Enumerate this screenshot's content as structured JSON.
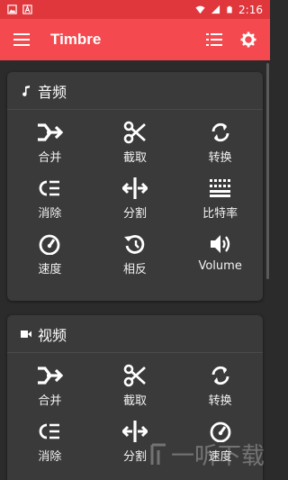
{
  "status_bar": {
    "time": "2:16"
  },
  "app_bar": {
    "title": "Timbre"
  },
  "audio_card": {
    "title": "音频",
    "tools": [
      {
        "label": "合并",
        "icon": "merge-icon"
      },
      {
        "label": "截取",
        "icon": "scissors-icon"
      },
      {
        "label": "转换",
        "icon": "convert-icon"
      },
      {
        "label": "消除",
        "icon": "remove-icon"
      },
      {
        "label": "分割",
        "icon": "split-icon"
      },
      {
        "label": "比特率",
        "icon": "bitrate-icon"
      },
      {
        "label": "速度",
        "icon": "speed-icon"
      },
      {
        "label": "相反",
        "icon": "reverse-icon"
      },
      {
        "label": "Volume",
        "icon": "volume-icon"
      }
    ]
  },
  "video_card": {
    "title": "视频",
    "tools": [
      {
        "label": "合并",
        "icon": "merge-icon"
      },
      {
        "label": "截取",
        "icon": "scissors-icon"
      },
      {
        "label": "转换",
        "icon": "convert-icon"
      },
      {
        "label": "消除",
        "icon": "remove-icon"
      },
      {
        "label": "分割",
        "icon": "split-icon"
      },
      {
        "label": "速度",
        "icon": "speed-icon"
      }
    ]
  },
  "watermark": {
    "text": "一听下载"
  },
  "colors": {
    "status_bar": "#e0373c",
    "app_bar": "#f44a4f",
    "background": "#2b2b2b",
    "card": "#3a3a3a"
  }
}
